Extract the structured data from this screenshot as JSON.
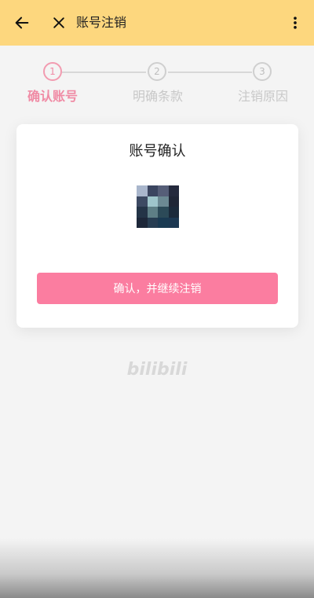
{
  "header": {
    "title": "账号注销",
    "back_icon": "arrow-left-icon",
    "close_icon": "close-icon",
    "more_icon": "more-vertical-icon",
    "bg_color": "#fdd77e"
  },
  "steps": [
    {
      "number": "1",
      "label": "确认账号",
      "active": true
    },
    {
      "number": "2",
      "label": "明确条款",
      "active": false
    },
    {
      "number": "3",
      "label": "注销原因",
      "active": false
    }
  ],
  "card": {
    "title": "账号确认",
    "confirm_label": "确认，并继续注销",
    "accent_color": "#fb7da0"
  },
  "footer": {
    "logo_text": "bilibili"
  }
}
